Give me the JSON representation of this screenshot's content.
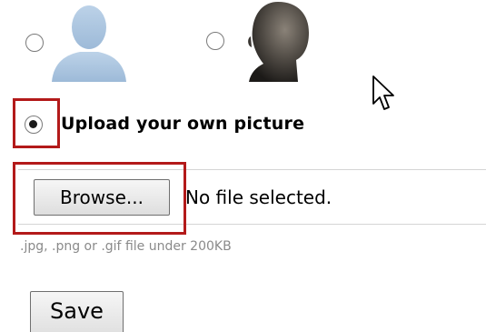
{
  "avatar_options": [
    {
      "name": "default-silhouette",
      "selected": false
    },
    {
      "name": "photo-silhouette",
      "selected": false
    }
  ],
  "upload_option": {
    "label": "Upload your own picture",
    "selected": true
  },
  "file_input": {
    "browse_label": "Browse...",
    "status_text": "No file selected."
  },
  "hint_text": ".jpg, .png or .gif file under 200KB",
  "save_label": "Save",
  "colors": {
    "highlight": "#b31a1a",
    "avatar_blue": "#a9c3de",
    "hint": "#8a8a8a"
  }
}
